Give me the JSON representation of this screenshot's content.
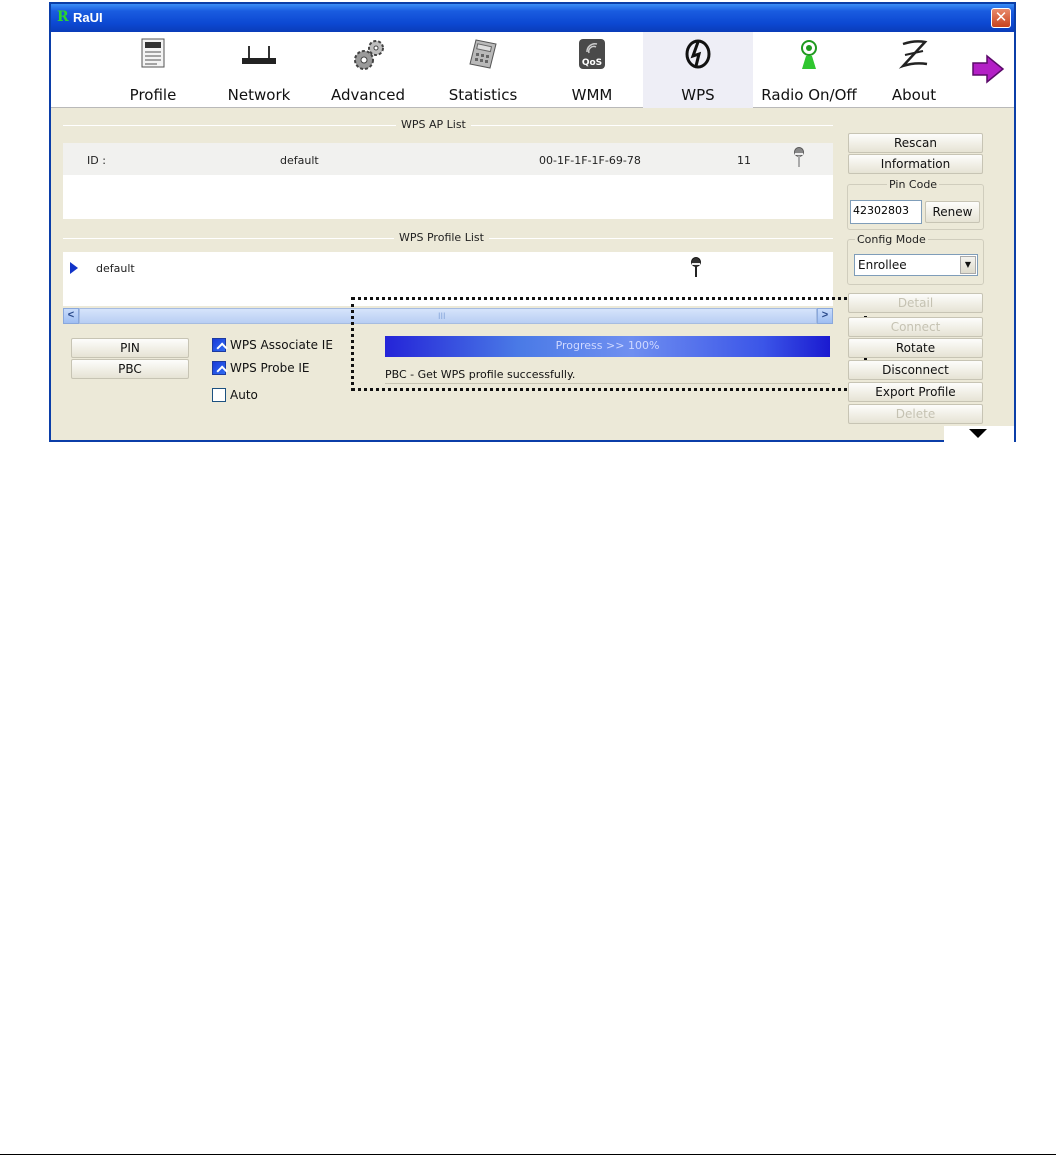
{
  "window": {
    "app_logo": "R",
    "title": "RaUI",
    "close_glyph": "✕"
  },
  "toolbar": {
    "items": [
      {
        "label": "Profile",
        "icon": "profile-icon"
      },
      {
        "label": "Network",
        "icon": "network-icon"
      },
      {
        "label": "Advanced",
        "icon": "advanced-icon"
      },
      {
        "label": "Statistics",
        "icon": "statistics-icon"
      },
      {
        "label": "WMM",
        "icon": "wmm-icon",
        "badge": "QoS"
      },
      {
        "label": "WPS",
        "icon": "wps-icon",
        "active": true
      },
      {
        "label": "Radio On/Off",
        "icon": "radio-icon"
      },
      {
        "label": "About",
        "icon": "about-icon"
      }
    ],
    "more_icon": "next-arrow-icon"
  },
  "ap_list": {
    "title": "WPS AP List",
    "row": {
      "id_label": "ID :",
      "name": "default",
      "bssid": "00-1F-1F-1F-69-78",
      "channel": "11",
      "icon": "key-icon"
    }
  },
  "profile_list": {
    "title": "WPS Profile List",
    "row": {
      "name": "default",
      "icon": "key-icon"
    },
    "scroll_thumb": "III"
  },
  "buttons": {
    "pin": "PIN",
    "pbc": "PBC"
  },
  "checkboxes": [
    {
      "label": "WPS Associate IE",
      "checked": true
    },
    {
      "label": "WPS Probe IE",
      "checked": true
    },
    {
      "label": "Auto",
      "checked": false
    }
  ],
  "progress": {
    "label": "Progress >> 100%",
    "value": 100
  },
  "status_text": "PBC - Get WPS profile successfully.",
  "side": {
    "rescan": "Rescan",
    "information": "Information",
    "pin_code_label": "Pin Code",
    "pin_code_value": "42302803",
    "renew": "Renew",
    "config_mode_label": "Config Mode",
    "config_mode_value": "Enrollee",
    "detail": "Detail",
    "connect": "Connect",
    "rotate": "Rotate",
    "disconnect": "Disconnect",
    "export_profile": "Export Profile",
    "delete": "Delete"
  },
  "colors": {
    "title_bar": "#0c48d2",
    "window_bg": "#ece9d8",
    "progress": "#2424d8"
  }
}
